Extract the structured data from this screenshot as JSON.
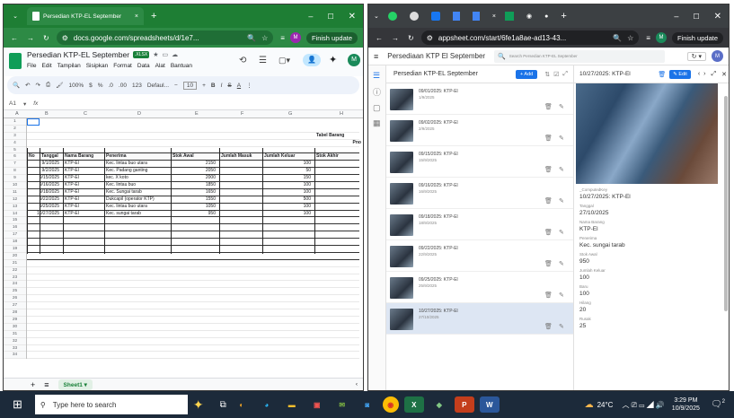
{
  "left_window": {
    "tab_title": "Persedian KTP-EL September",
    "url": "docs.google.com/spreadsheets/d/1e7...",
    "finish_update": "Finish update",
    "doc_title": "Persedian KTP-EL September",
    "doc_badge": ".XLSX",
    "menu": [
      "File",
      "Edit",
      "Tampilan",
      "Sisipkan",
      "Format",
      "Data",
      "Alat",
      "Bantuan"
    ],
    "toolbar": {
      "zoom": "100%",
      "currency": "$",
      "percent": "%",
      "dec1": ".0",
      "dec2": ".00",
      "num": "123",
      "font": "Defaul...",
      "font_size": "10",
      "bold": "B",
      "italic": "I",
      "strike": "S",
      "textcolor": "A"
    },
    "name_box": "A1",
    "fx": "fx",
    "columns": [
      "A",
      "B",
      "C",
      "D",
      "E",
      "F",
      "G",
      "H"
    ],
    "row_numbers": [
      "1",
      "2",
      "3",
      "4",
      "5",
      "6",
      "7",
      "8",
      "9",
      "10",
      "11",
      "12",
      "13",
      "14",
      "15",
      "16",
      "17",
      "18",
      "19",
      "20",
      "21",
      "22",
      "23",
      "24",
      "25",
      "26",
      "27",
      "28",
      "29",
      "30",
      "31",
      "32",
      "33",
      "34"
    ],
    "sheet_title_1": "Tabel Barang",
    "sheet_title_2": "Pno",
    "headers": [
      "No",
      "Tanggal",
      "Nama Barang",
      "Penerima",
      "Stok Awal",
      "Jumlah Masuk",
      "Jumlah Keluar",
      "Stok Akhir"
    ],
    "rows": [
      {
        "tanggal": "9/1/2025",
        "barang": "KTP-El",
        "penerima": "Kec. lintau buo utara",
        "stok_awal": "2150",
        "keluar": "100"
      },
      {
        "tanggal": "9/2/2025",
        "barang": "KTP-El",
        "penerima": "Kec. Padang ganting",
        "stok_awal": "2050",
        "keluar": "50"
      },
      {
        "tanggal": "9/15/2025",
        "barang": "KTP-El",
        "penerima": "kec. X koto",
        "stok_awal": "2000",
        "keluar": "150"
      },
      {
        "tanggal": "9/16/2025",
        "barang": "KTP-El",
        "penerima": "Kec. lintau buo",
        "stok_awal": "1850",
        "keluar": "100"
      },
      {
        "tanggal": "9/18/2025",
        "barang": "KTP-El",
        "penerima": "Kec. Sungai tarab",
        "stok_awal": "1650",
        "keluar": "100"
      },
      {
        "tanggal": "9/22/2025",
        "barang": "KTP-El",
        "penerima": "Dukcapil (operator KTP)",
        "stok_awal": "1550",
        "keluar": "500"
      },
      {
        "tanggal": "9/25/2025",
        "barang": "KTP-El",
        "penerima": "Kec. lintau buo utara",
        "stok_awal": "1050",
        "keluar": "100"
      },
      {
        "tanggal": "10/27/2025",
        "barang": "KTP-El",
        "penerima": "Kec. sungai tarab",
        "stok_awal": "950",
        "keluar": "100"
      }
    ],
    "sheet_tab": "Sheet1"
  },
  "right_window": {
    "url": "appsheet.com/start/6fe1a8ae-ad13-43...",
    "finish_update": "Finish update",
    "app_title": "Persediaan KTP El September",
    "search_placeholder": "Search Persedian KTP-EL September",
    "view_title": "Persedian KTP-EL September",
    "add_label": "+ Add",
    "detail_title": "10/27/2025: KTP-El",
    "edit_label": "Edit",
    "list": [
      {
        "title": "09/01/2025: KTP-El",
        "sub": "1/9/2025"
      },
      {
        "title": "09/02/2025: KTP-El",
        "sub": "2/9/2025"
      },
      {
        "title": "09/15/2025: KTP-El",
        "sub": "15/9/2025"
      },
      {
        "title": "09/16/2025: KTP-El",
        "sub": "16/9/2025"
      },
      {
        "title": "09/18/2025: KTP-El",
        "sub": "18/9/2025"
      },
      {
        "title": "09/22/2025: KTP-El",
        "sub": "22/9/2025"
      },
      {
        "title": "09/25/2025: KTP-El",
        "sub": "25/9/2025"
      },
      {
        "title": "10/27/2025: KTP-El",
        "sub": "27/10/2025"
      }
    ],
    "details": [
      {
        "label": "_ComputedKey",
        "value": "10/27/2025: KTP-El"
      },
      {
        "label": "Tanggal",
        "value": "27/10/2025"
      },
      {
        "label": "Nama Barang",
        "value": "KTP-El"
      },
      {
        "label": "Penerima",
        "value": "Kec. sungai tarab"
      },
      {
        "label": "Stok Awal",
        "value": "950"
      },
      {
        "label": "Jumlah Keluar",
        "value": "100"
      },
      {
        "label": "Baru",
        "value": "100"
      },
      {
        "label": "Hilang",
        "value": "20"
      },
      {
        "label": "Rusak",
        "value": "25"
      }
    ]
  },
  "taskbar": {
    "search": "Type here to search",
    "temp": "24°C",
    "time": "3:29 PM",
    "date": "10/9/2025",
    "notif": "2"
  },
  "colors": {
    "sheets_green": "#1e7e34",
    "appsheet_blue": "#1a73e8",
    "taskbar": "#1c2a3a"
  }
}
